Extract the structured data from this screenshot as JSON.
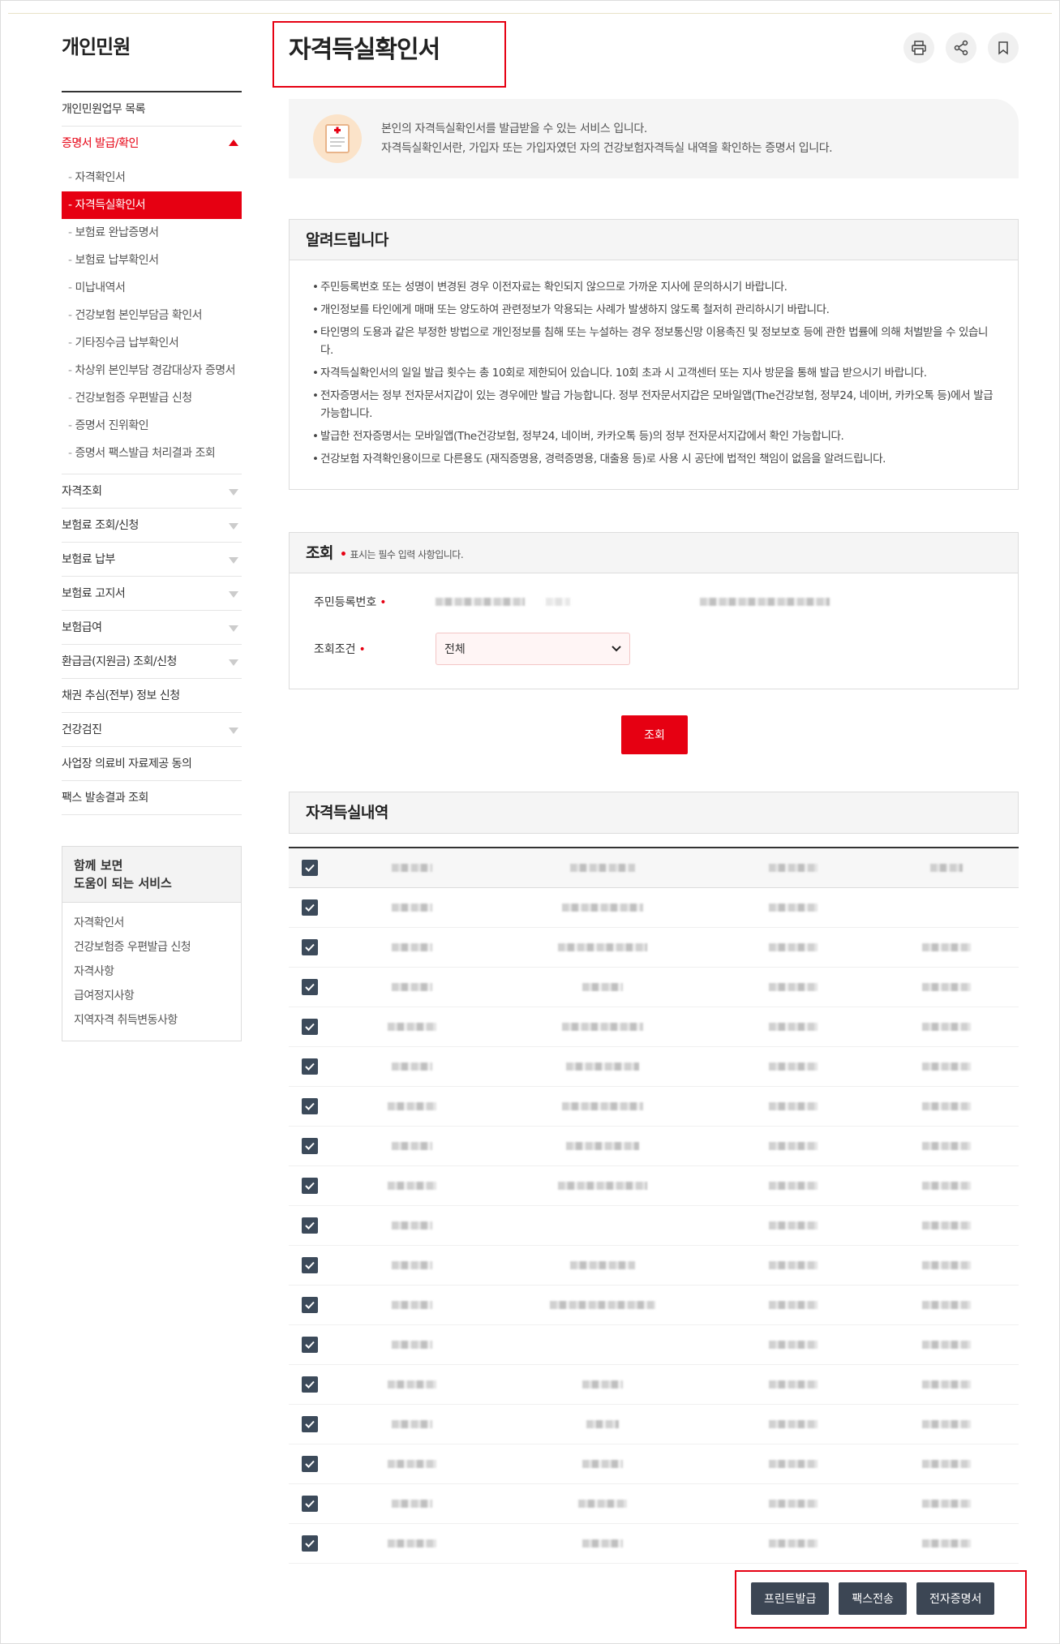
{
  "sidebar": {
    "title": "개인민원",
    "items_top": [
      {
        "label": "개인민원업무 목록"
      }
    ],
    "active_group": {
      "label": "증명서 발급/확인",
      "sub_items": [
        {
          "label": "자격확인서"
        },
        {
          "label": "자격득실확인서"
        },
        {
          "label": "보험료 완납증명서"
        },
        {
          "label": "보험료 납부확인서"
        },
        {
          "label": "미납내역서"
        },
        {
          "label": "건강보험 본인부담금 확인서"
        },
        {
          "label": "기타징수금 납부확인서"
        },
        {
          "label": "차상위 본인부담 경감대상자 증명서"
        },
        {
          "label": "건강보험증 우편발급 신청"
        },
        {
          "label": "증명서 진위확인"
        },
        {
          "label": "증명서 팩스발급 처리결과 조회"
        }
      ]
    },
    "items_bottom": [
      {
        "label": "자격조회"
      },
      {
        "label": "보험료 조회/신청"
      },
      {
        "label": "보험료 납부"
      },
      {
        "label": "보험료 고지서"
      },
      {
        "label": "보험급여"
      },
      {
        "label": "환급금(지원금) 조회/신청"
      },
      {
        "label": "채권 추심(전부) 정보 신청"
      },
      {
        "label": "건강검진"
      },
      {
        "label": "사업장 의료비 자료제공 동의"
      },
      {
        "label": "팩스 발송결과 조회"
      }
    ],
    "related": {
      "title_line1": "함께 보면",
      "title_line2": "도움이 되는 서비스",
      "links": [
        {
          "label": "자격확인서"
        },
        {
          "label": "건강보험증 우편발급 신청"
        },
        {
          "label": "자격사항"
        },
        {
          "label": "급여정지사항"
        },
        {
          "label": "지역자격 취득변동사항"
        }
      ]
    }
  },
  "main": {
    "page_title": "자격득실확인서",
    "intro": {
      "line1": "본인의 자격득실확인서를 발급받을 수 있는 서비스 입니다.",
      "line2": "자격득실확인서란, 가입자 또는 가입자였던 자의 건강보험자격득실 내역을 확인하는 증명서 입니다."
    },
    "notice": {
      "title": "알려드립니다",
      "items": [
        "주민등록번호 또는 성명이 변경된 경우 이전자료는 확인되지 않으므로 가까운 지사에 문의하시기 바랍니다.",
        "개인정보를 타인에게 매매 또는 양도하여 관련정보가 악용되는 사례가 발생하지 않도록 철저히 관리하시기 바랍니다.",
        "타인명의 도용과 같은 부정한 방법으로 개인정보를 침해 또는 누설하는 경우 정보통신망 이용촉진 및 정보보호 등에 관한 법률에 의해 처벌받을 수 있습니다.",
        "자격득실확인서의 일일 발급 횟수는 총 10회로 제한되어 있습니다. 10회 초과 시 고객센터 또는 지사 방문을 통해 발급 받으시기 바랍니다.",
        "전자증명서는 정부 전자문서지갑이 있는 경우에만 발급 가능합니다. 정부 전자문서지갑은 모바일앱(The건강보험, 정부24, 네이버, 카카오톡 등)에서 발급 가능합니다.",
        "발급한 전자증명서는 모바일앱(The건강보험, 정부24, 네이버, 카카오톡 등)의 정부 전자문서지갑에서 확인 가능합니다.",
        "건강보험 자격확인용이므로 다른용도 (재직증명용, 경력증명용, 대출용 등)로 사용 시 공단에 법적인 책임이 없음을 알려드립니다."
      ]
    },
    "search": {
      "title": "조회",
      "required_note": "표시는 필수 입력 사항입니다.",
      "resident_label": "주민등록번호",
      "condition_label": "조회조건",
      "condition_value": "전체",
      "submit_label": "조회"
    },
    "results": {
      "title": "자격득실내역",
      "row_count": 18
    },
    "actions": {
      "print_label": "프린트발급",
      "fax_label": "팩스전송",
      "ecert_label": "전자증명서"
    }
  },
  "colors": {
    "accent": "#e60012",
    "dark_button": "#3c4654",
    "checkbox": "#3c4a5a"
  }
}
